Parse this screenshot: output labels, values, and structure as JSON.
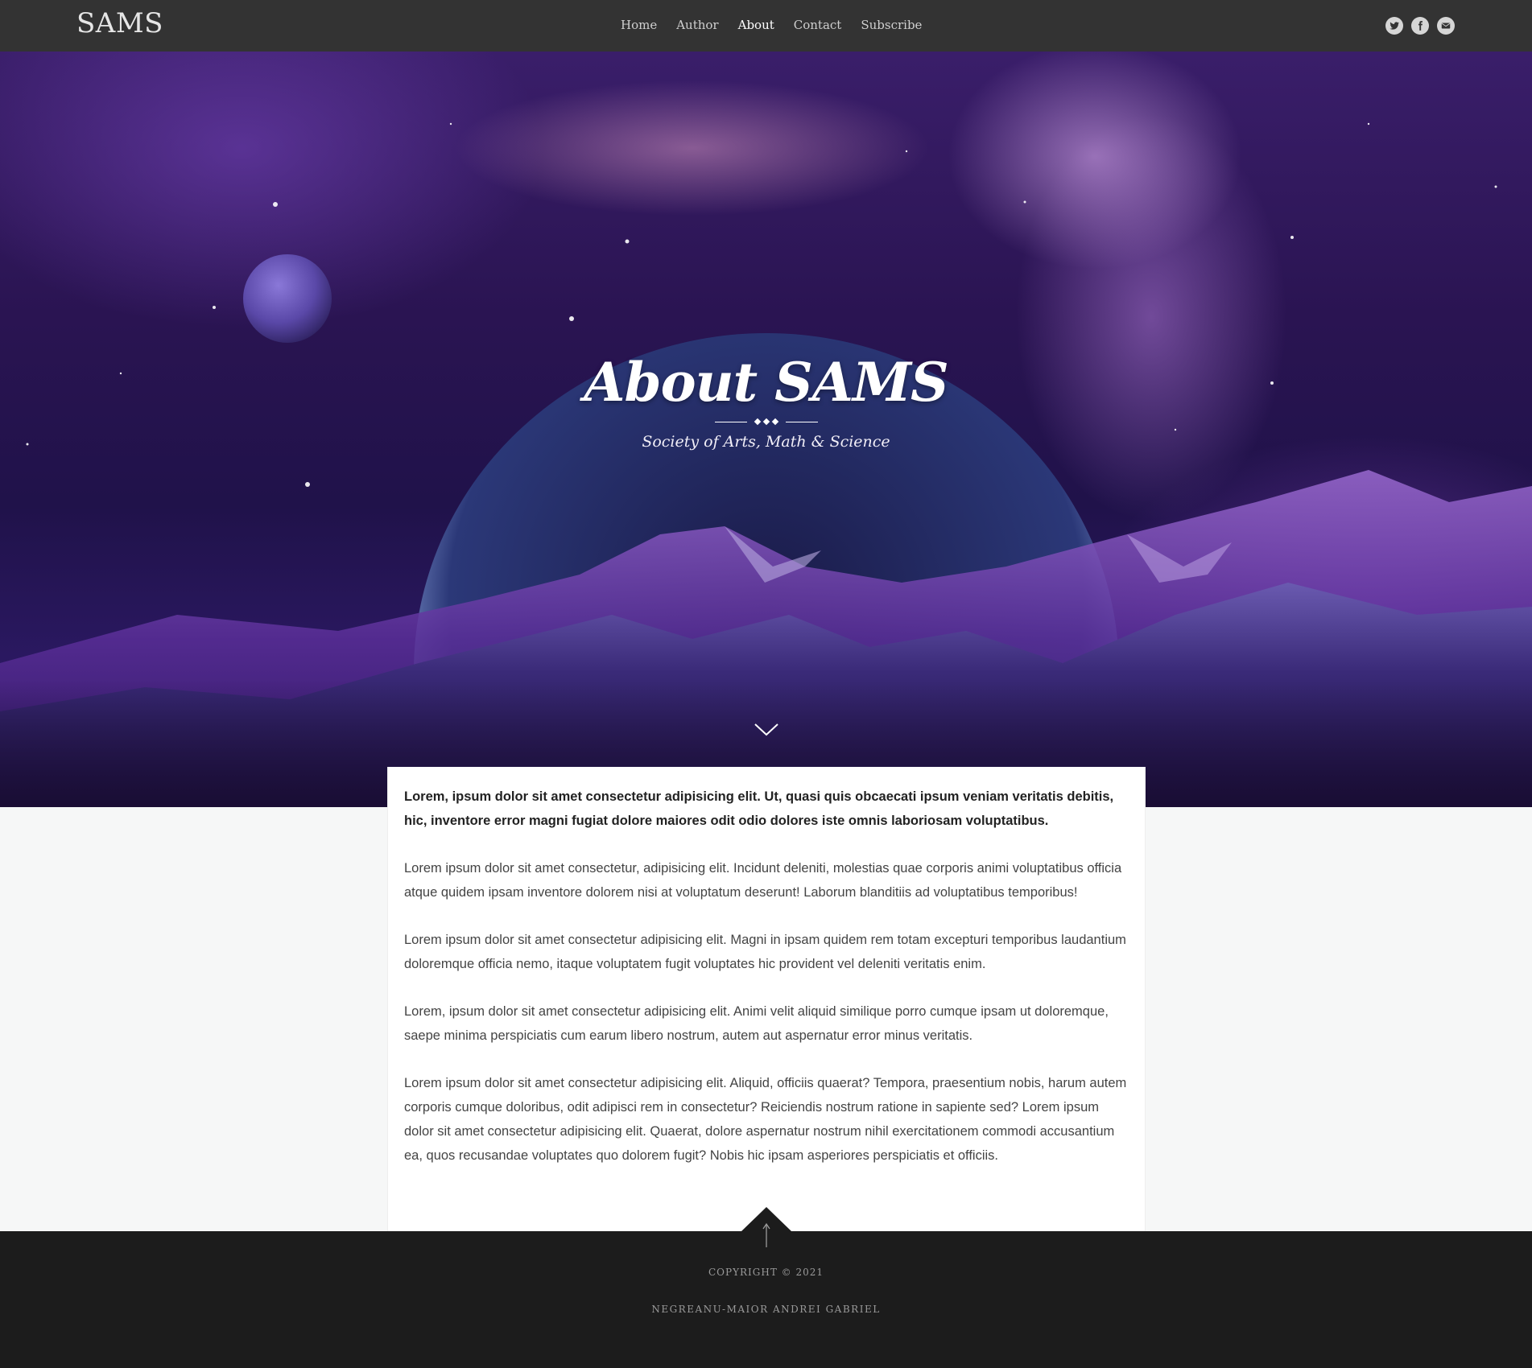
{
  "nav": {
    "brand": "SAMS",
    "links": [
      {
        "label": "Home",
        "active": false
      },
      {
        "label": "Author",
        "active": false
      },
      {
        "label": "About",
        "active": true
      },
      {
        "label": "Contact",
        "active": false
      },
      {
        "label": "Subscribe",
        "active": false
      }
    ],
    "social_icons": [
      "twitter-icon",
      "facebook-icon",
      "email-icon"
    ]
  },
  "hero": {
    "title": "About SAMS",
    "subtitle": "Society of Arts, Math & Science",
    "scroll_icon": "chevron-down-icon"
  },
  "content": {
    "lead": "Lorem, ipsum dolor sit amet consectetur adipisicing elit. Ut, quasi quis obcaecati ipsum veniam veritatis debitis, hic, inventore error magni fugiat dolore maiores odit odio dolores iste omnis laboriosam voluptatibus.",
    "paragraphs": [
      "Lorem ipsum dolor sit amet consectetur, adipisicing elit. Incidunt deleniti, molestias quae corporis animi voluptatibus officia atque quidem ipsam inventore dolorem nisi at voluptatum deserunt! Laborum blanditiis ad voluptatibus temporibus!",
      "Lorem ipsum dolor sit amet consectetur adipisicing elit. Magni in ipsam quidem rem totam excepturi temporibus laudantium doloremque officia nemo, itaque voluptatem fugit voluptates hic provident vel deleniti veritatis enim.",
      "Lorem, ipsum dolor sit amet consectetur adipisicing elit. Animi velit aliquid similique porro cumque ipsam ut doloremque, saepe minima perspiciatis cum earum libero nostrum, autem aut aspernatur error minus veritatis.",
      "Lorem ipsum dolor sit amet consectetur adipisicing elit. Aliquid, officiis quaerat? Tempora, praesentium nobis, harum autem corporis cumque doloribus, odit adipisci rem in consectetur? Reiciendis nostrum ratione in sapiente sed? Lorem ipsum dolor sit amet consectetur adipisicing elit. Quaerat, dolore aspernatur nostrum nihil exercitationem commodi accusantium ea, quos recusandae voluptates quo dolorem fugit? Nobis hic ipsam asperiores perspiciatis et officiis."
    ]
  },
  "footer": {
    "to_top_icon": "arrow-up-icon",
    "copyright": "COPYRIGHT © 2021",
    "author": "NEGREANU-MAIOR ANDREI GABRIEL"
  },
  "colors": {
    "navbar_bg": "#333333",
    "footer_bg": "#1c1c1c",
    "page_bg": "#f6f7f7",
    "hero_accent": "#6a3bb0"
  }
}
